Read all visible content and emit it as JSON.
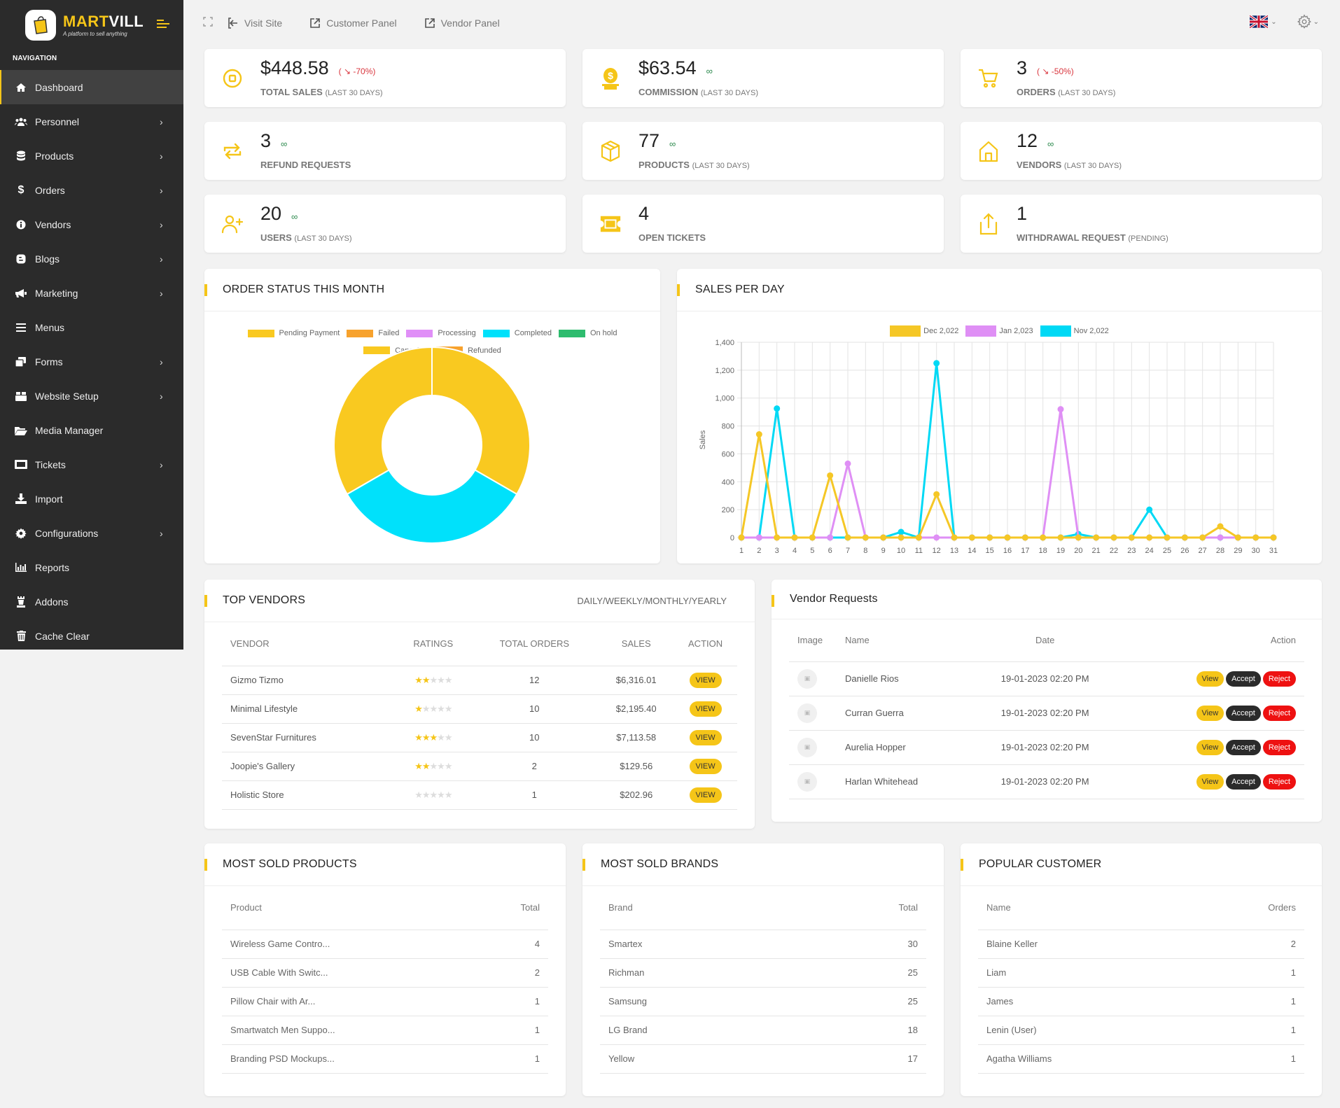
{
  "brand": {
    "name_part1": "MART",
    "name_part2": "VILL",
    "tagline": "A platform to sell anything"
  },
  "sidebar": {
    "section_label": "NAVIGATION",
    "items": [
      {
        "label": "Dashboard",
        "icon": "home-icon",
        "active": true,
        "has_children": false
      },
      {
        "label": "Personnel",
        "icon": "users-icon",
        "has_children": true
      },
      {
        "label": "Products",
        "icon": "database-icon",
        "has_children": true
      },
      {
        "label": "Orders",
        "icon": "dollar-icon",
        "has_children": true
      },
      {
        "label": "Vendors",
        "icon": "info-circle-icon",
        "has_children": true
      },
      {
        "label": "Blogs",
        "icon": "blogger-icon",
        "has_children": true
      },
      {
        "label": "Marketing",
        "icon": "megaphone-icon",
        "has_children": true
      },
      {
        "label": "Menus",
        "icon": "bars-icon",
        "has_children": false
      },
      {
        "label": "Forms",
        "icon": "window-restore-icon",
        "has_children": true
      },
      {
        "label": "Website Setup",
        "icon": "box-icon",
        "has_children": true
      },
      {
        "label": "Media Manager",
        "icon": "folder-open-icon",
        "has_children": false
      },
      {
        "label": "Tickets",
        "icon": "ticket-icon",
        "has_children": true
      },
      {
        "label": "Import",
        "icon": "download-icon",
        "has_children": false
      },
      {
        "label": "Configurations",
        "icon": "cog-icon",
        "has_children": true
      },
      {
        "label": "Reports",
        "icon": "bar-chart-icon",
        "has_children": false
      },
      {
        "label": "Addons",
        "icon": "chess-rook-icon",
        "has_children": false
      },
      {
        "label": "Cache Clear",
        "icon": "trash-icon",
        "has_children": false
      }
    ]
  },
  "topbar": {
    "links": [
      {
        "label": "Visit Site",
        "icon": "sign-in-icon"
      },
      {
        "label": "Customer Panel",
        "icon": "external-link-icon"
      },
      {
        "label": "Vendor Panel",
        "icon": "external-link-icon"
      }
    ],
    "language": "en-GB",
    "language_icon": "uk-flag-icon",
    "settings_icon": "gear-icon"
  },
  "stats": [
    {
      "value": "$448.58",
      "change": "-70%",
      "trend": "down",
      "label": "TOTAL SALES",
      "sublabel": "(LAST 30 DAYS)",
      "icon": "coin-icon"
    },
    {
      "value": "$63.54",
      "change": "∞",
      "trend": "infinite",
      "label": "COMMISSION",
      "sublabel": "(LAST 30 DAYS)",
      "icon": "money-bag-icon"
    },
    {
      "value": "3",
      "change": "-50%",
      "trend": "down",
      "label": "ORDERS",
      "sublabel": "(LAST 30 DAYS)",
      "icon": "cart-icon"
    },
    {
      "value": "3",
      "change": "∞",
      "trend": "infinite",
      "label": "REFUND REQUESTS",
      "sublabel": "",
      "icon": "refund-arrows-icon"
    },
    {
      "value": "77",
      "change": "∞",
      "trend": "infinite",
      "label": "PRODUCTS",
      "sublabel": "(LAST 30 DAYS)",
      "icon": "box-icon"
    },
    {
      "value": "12",
      "change": "∞",
      "trend": "infinite",
      "label": "VENDORS",
      "sublabel": "(LAST 30 DAYS)",
      "icon": "store-icon"
    },
    {
      "value": "20",
      "change": "∞",
      "trend": "infinite",
      "label": "USERS",
      "sublabel": "(LAST 30 DAYS)",
      "icon": "user-plus-icon"
    },
    {
      "value": "4",
      "change": "",
      "trend": "none",
      "label": "OPEN TICKETS",
      "sublabel": "",
      "icon": "ticket-icon"
    },
    {
      "value": "1",
      "change": "",
      "trend": "none",
      "label": "WITHDRAWAL REQUEST",
      "sublabel": "(PENDING)",
      "icon": "upload-icon"
    }
  ],
  "colors": {
    "accent": "#f5c518",
    "sidebar_bg": "#2b2b2b",
    "danger": "#ee1111",
    "trend_down": "#d9363e",
    "trend_infinite": "#2d8a4e"
  },
  "order_status": {
    "title": "ORDER STATUS THIS MONTH"
  },
  "sales_per_day": {
    "title": "SALES PER DAY"
  },
  "chart_data": [
    {
      "type": "pie",
      "variant": "doughnut",
      "title": "ORDER STATUS THIS MONTH",
      "legend_position": "top",
      "categories": [
        "Pending Payment",
        "Failed",
        "Processing",
        "Completed",
        "On hold",
        "Cancelled",
        "Refunded"
      ],
      "colors": [
        "#f9c920",
        "#f7a22d",
        "#e08ff7",
        "#00e1fb",
        "#2ebc6e",
        "#f9c920",
        "#f7a22d"
      ],
      "values": [
        1,
        0,
        0,
        1,
        0,
        1,
        0
      ]
    },
    {
      "type": "line",
      "title": "SALES PER DAY",
      "xlabel": "",
      "ylabel": "Sales",
      "ylim": [
        0,
        1400
      ],
      "yticks": [
        0,
        200,
        400,
        600,
        800,
        1000,
        1200,
        1400
      ],
      "yticks_labels": [
        "0",
        "200",
        "400",
        "600",
        "800",
        "1,000",
        "1,200",
        "1,400"
      ],
      "grid": true,
      "legend_position": "top",
      "x": [
        1,
        2,
        3,
        4,
        5,
        6,
        7,
        8,
        9,
        10,
        11,
        12,
        13,
        14,
        15,
        16,
        17,
        18,
        19,
        20,
        21,
        22,
        23,
        24,
        25,
        26,
        27,
        28,
        29,
        30,
        31
      ],
      "series": [
        {
          "name": "Nov 2,022",
          "color": "#00d9f5",
          "values": [
            0,
            0,
            925,
            0,
            0,
            0,
            0,
            0,
            0,
            40,
            0,
            1250,
            0,
            0,
            0,
            0,
            0,
            0,
            0,
            25,
            0,
            0,
            0,
            200,
            0,
            0,
            0,
            0,
            0,
            0,
            0
          ]
        },
        {
          "name": "Jan 2,023",
          "color": "#df8ff5",
          "values": [
            0,
            0,
            0,
            0,
            0,
            0,
            530,
            0,
            0,
            0,
            0,
            0,
            0,
            0,
            0,
            0,
            0,
            0,
            920,
            0,
            0,
            0,
            0,
            0,
            0,
            0,
            0,
            0,
            0,
            0,
            0
          ]
        },
        {
          "name": "Dec 2,022",
          "color": "#f5c726",
          "values": [
            0,
            740,
            0,
            0,
            0,
            445,
            0,
            0,
            0,
            0,
            0,
            310,
            0,
            0,
            0,
            0,
            0,
            0,
            0,
            0,
            0,
            0,
            0,
            0,
            0,
            0,
            0,
            80,
            0,
            0,
            0
          ]
        }
      ],
      "legend_order": [
        "Dec 2,022",
        "Jan 2,023",
        "Nov 2,022"
      ]
    }
  ],
  "top_vendors": {
    "title": "TOP VENDORS",
    "period_filter": "DAILY/WEEKLY/MONTHLY/YEARLY",
    "columns": [
      "VENDOR",
      "RATINGS",
      "TOTAL ORDERS",
      "SALES",
      "ACTION"
    ],
    "rows": [
      {
        "vendor": "Gizmo Tizmo",
        "rating": 2,
        "orders": "12",
        "sales": "$6,316.01",
        "action": "VIEW"
      },
      {
        "vendor": "Minimal Lifestyle",
        "rating": 1,
        "orders": "10",
        "sales": "$2,195.40",
        "action": "VIEW"
      },
      {
        "vendor": "SevenStar Furnitures",
        "rating": 3,
        "orders": "10",
        "sales": "$7,113.58",
        "action": "VIEW"
      },
      {
        "vendor": "Joopie's Gallery",
        "rating": 2,
        "orders": "2",
        "sales": "$129.56",
        "action": "VIEW"
      },
      {
        "vendor": "Holistic Store",
        "rating": 0,
        "orders": "1",
        "sales": "$202.96",
        "action": "VIEW"
      }
    ]
  },
  "vendor_requests": {
    "title": "Vendor Requests",
    "columns": [
      "Image",
      "Name",
      "Date",
      "Action"
    ],
    "buttons": {
      "view": "View",
      "accept": "Accept",
      "reject": "Reject"
    },
    "rows": [
      {
        "name": "Danielle Rios",
        "date": "19-01-2023 02:20 PM"
      },
      {
        "name": "Curran Guerra",
        "date": "19-01-2023 02:20 PM"
      },
      {
        "name": "Aurelia Hopper",
        "date": "19-01-2023 02:20 PM"
      },
      {
        "name": "Harlan Whitehead",
        "date": "19-01-2023 02:20 PM"
      }
    ]
  },
  "most_sold_products": {
    "title": "MOST SOLD PRODUCTS",
    "columns": [
      "Product",
      "Total"
    ],
    "rows": [
      {
        "name": "Wireless Game Contro...",
        "total": "4"
      },
      {
        "name": "USB Cable With Switc...",
        "total": "2"
      },
      {
        "name": "Pillow Chair with Ar...",
        "total": "1"
      },
      {
        "name": "Smartwatch Men Suppo...",
        "total": "1"
      },
      {
        "name": "Branding PSD Mockups...",
        "total": "1"
      }
    ]
  },
  "most_sold_brands": {
    "title": "MOST SOLD BRANDS",
    "columns": [
      "Brand",
      "Total"
    ],
    "rows": [
      {
        "name": "Smartex",
        "total": "30"
      },
      {
        "name": "Richman",
        "total": "25"
      },
      {
        "name": "Samsung",
        "total": "25"
      },
      {
        "name": "LG Brand",
        "total": "18"
      },
      {
        "name": "Yellow",
        "total": "17"
      }
    ]
  },
  "popular_customer": {
    "title": "POPULAR CUSTOMER",
    "columns": [
      "Name",
      "Orders"
    ],
    "rows": [
      {
        "name": "Blaine Keller",
        "total": "2"
      },
      {
        "name": "Liam",
        "total": "1"
      },
      {
        "name": "James",
        "total": "1"
      },
      {
        "name": "Lenin (User)",
        "total": "1"
      },
      {
        "name": "Agatha Williams",
        "total": "1"
      }
    ]
  }
}
